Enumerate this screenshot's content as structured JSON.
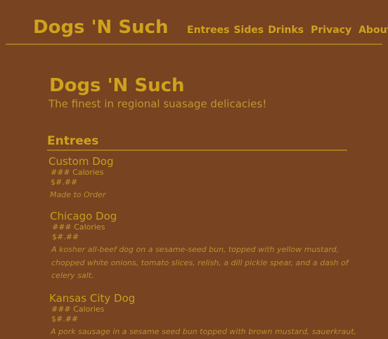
{
  "header": {
    "logo": "Dogs 'N Such",
    "nav": [
      "Entrees",
      "Sides",
      "Drinks",
      "Privacy",
      "About"
    ]
  },
  "main": {
    "title": "Dogs 'N Such",
    "tagline": "The finest in regional suasage delicacies!"
  },
  "section": {
    "title": "Entrees",
    "items": [
      {
        "name": "Custom Dog",
        "calories": "### Calories",
        "price": "$#.##",
        "description": "Made to Order"
      },
      {
        "name": "Chicago Dog",
        "calories": "### Calories",
        "price": "$#.##",
        "description": "A kosher all-beef dog on a sesame-seed bun, topped with yellow mustard, chopped white onions, tomato slices, relish, a dill pickle spear, and a dash of celery salt."
      },
      {
        "name": "Kansas City Dog",
        "calories": "### Calories",
        "price": "$#.##",
        "description": "A pork sausage in a sesame seed bun topped with brown mustard, sauerkraut,"
      }
    ]
  },
  "colors": {
    "background": "#774321",
    "accent": "#cfa21b",
    "rule": "#a27920"
  }
}
